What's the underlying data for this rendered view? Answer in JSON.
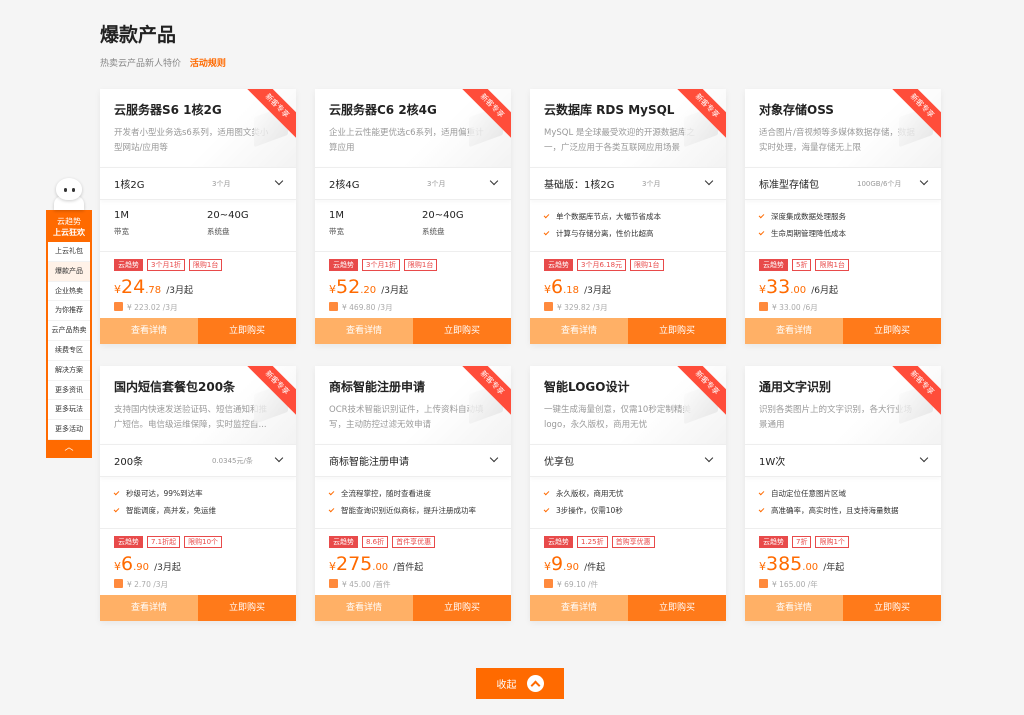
{
  "section": {
    "title": "爆款产品",
    "subtitle": "热卖云产品新人特价",
    "rules_link": "活动规则"
  },
  "sidenav": {
    "head1": "云趋势",
    "head2": "上云狂欢",
    "items": [
      "上云礼包",
      "爆款产品",
      "企业热卖",
      "为你推荐",
      "云产品热卖",
      "续费专区",
      "解决方案",
      "更多资讯",
      "更多玩法",
      "更多活动"
    ],
    "up_label": "︿"
  },
  "cards": [
    {
      "name": "云服务器S6 1核2G",
      "ribbon": "新客专享",
      "desc": "开发者小型业务选s6系列，适用图文类小型网站/应用等",
      "select": "1核2G",
      "select_hint": "3个月",
      "specs": [
        {
          "value": "1M",
          "label": "带宽"
        },
        {
          "value": "20~40G",
          "label": "系统盘"
        }
      ],
      "tags": [
        "云趋势",
        "3个月1折",
        "限购1台"
      ],
      "price_int": "24",
      "price_dec": ".78",
      "price_unit": "/3月起",
      "original": "¥ 223.02 /3月",
      "btn_detail": "查看详情",
      "btn_buy": "立即购买"
    },
    {
      "name": "云服务器C6 2核4G",
      "ribbon": "新客专享",
      "desc": "企业上云性能更优选c6系列，适用偏重计算应用",
      "select": "2核4G",
      "select_hint": "3个月",
      "specs": [
        {
          "value": "1M",
          "label": "带宽"
        },
        {
          "value": "20~40G",
          "label": "系统盘"
        }
      ],
      "tags": [
        "云趋势",
        "3个月1折",
        "限购1台"
      ],
      "price_int": "52",
      "price_dec": ".20",
      "price_unit": "/3月起",
      "original": "¥ 469.80 /3月",
      "btn_detail": "查看详情",
      "btn_buy": "立即购买"
    },
    {
      "name": "云数据库 RDS MySQL",
      "ribbon": "新客专享",
      "desc": "MySQL 是全球最受欢迎的开源数据库之一，广泛应用于各类互联网应用场景",
      "select": "基础版：1核2G",
      "select_hint": "3个月",
      "features": [
        "单个数据库节点，大幅节省成本",
        "计算与存储分离，性价比超高"
      ],
      "tags": [
        "云趋势",
        "3个月6.18元",
        "限购1台"
      ],
      "price_int": "6",
      "price_dec": ".18",
      "price_unit": "/3月起",
      "original": "¥ 329.82 /3月",
      "btn_detail": "查看详情",
      "btn_buy": "立即购买"
    },
    {
      "name": "对象存储OSS",
      "ribbon": "新客专享",
      "desc": "适合图片/音视频等多媒体数据存储，数据实时处理，海量存储无上限",
      "select": "标准型存储包",
      "select_hint": "100GB/6个月",
      "features": [
        "深度集成数据处理服务",
        "生命周期管理降低成本"
      ],
      "tags": [
        "云趋势",
        "5折",
        "限购1台"
      ],
      "price_int": "33",
      "price_dec": ".00",
      "price_unit": "/6月起",
      "original": "¥ 33.00 /6月",
      "btn_detail": "查看详情",
      "btn_buy": "立即购买"
    },
    {
      "name": "国内短信套餐包200条",
      "ribbon": "新客专享",
      "desc": "支持国内快速发送验证码、短信通知和推广短信。电信级运维保障，实时监控自...",
      "select": "200条",
      "select_hint": "0.0345元/条",
      "features": [
        "秒级可达，99%到达率",
        "智能调度，高并发，免运维"
      ],
      "tags": [
        "云趋势",
        "7.1折起",
        "限购10个"
      ],
      "price_int": "6",
      "price_dec": ".90",
      "price_unit": "/3月起",
      "original": "¥ 2.70 /3月",
      "btn_detail": "查看详情",
      "btn_buy": "立即购买"
    },
    {
      "name": "商标智能注册申请",
      "ribbon": "新客专享",
      "desc": "OCR技术智能识别证件，上传资料自动填写，主动防控过滤无效申请",
      "select": "商标智能注册申请",
      "select_hint": "",
      "features": [
        "全流程掌控，随时查看进度",
        "智能查询识别近似商标，提升注册成功率"
      ],
      "tags": [
        "云趋势",
        "8.6折",
        "首件享优惠"
      ],
      "price_int": "275",
      "price_dec": ".00",
      "price_unit": "/首件起",
      "original": "¥ 45.00 /首件",
      "btn_detail": "查看详情",
      "btn_buy": "立即购买"
    },
    {
      "name": "智能LOGO设计",
      "ribbon": "新客专享",
      "desc": "一键生成海量创意，仅需10秒定制精美logo，永久版权，商用无忧",
      "select": "优享包",
      "select_hint": "",
      "features": [
        "永久版权，商用无忧",
        "3步操作，仅需10秒"
      ],
      "tags": [
        "云趋势",
        "1.25折",
        "首购享优惠"
      ],
      "price_int": "9",
      "price_dec": ".90",
      "price_unit": "/件起",
      "original": "¥ 69.10 /件",
      "btn_detail": "查看详情",
      "btn_buy": "立即购买"
    },
    {
      "name": "通用文字识别",
      "ribbon": "新客专享",
      "desc": "识别各类图片上的文字识别，各大行业场景通用",
      "select": "1W次",
      "select_hint": "",
      "features": [
        "自动定位任意图片区域",
        "高准确率，高实时性，且支持海量数据"
      ],
      "tags": [
        "云趋势",
        "7折",
        "限购1个"
      ],
      "price_int": "385",
      "price_dec": ".00",
      "price_unit": "/年起",
      "original": "¥ 165.00 /年",
      "btn_detail": "查看详情",
      "btn_buy": "立即购买"
    }
  ],
  "collapse_label": "收起",
  "currency": "¥"
}
